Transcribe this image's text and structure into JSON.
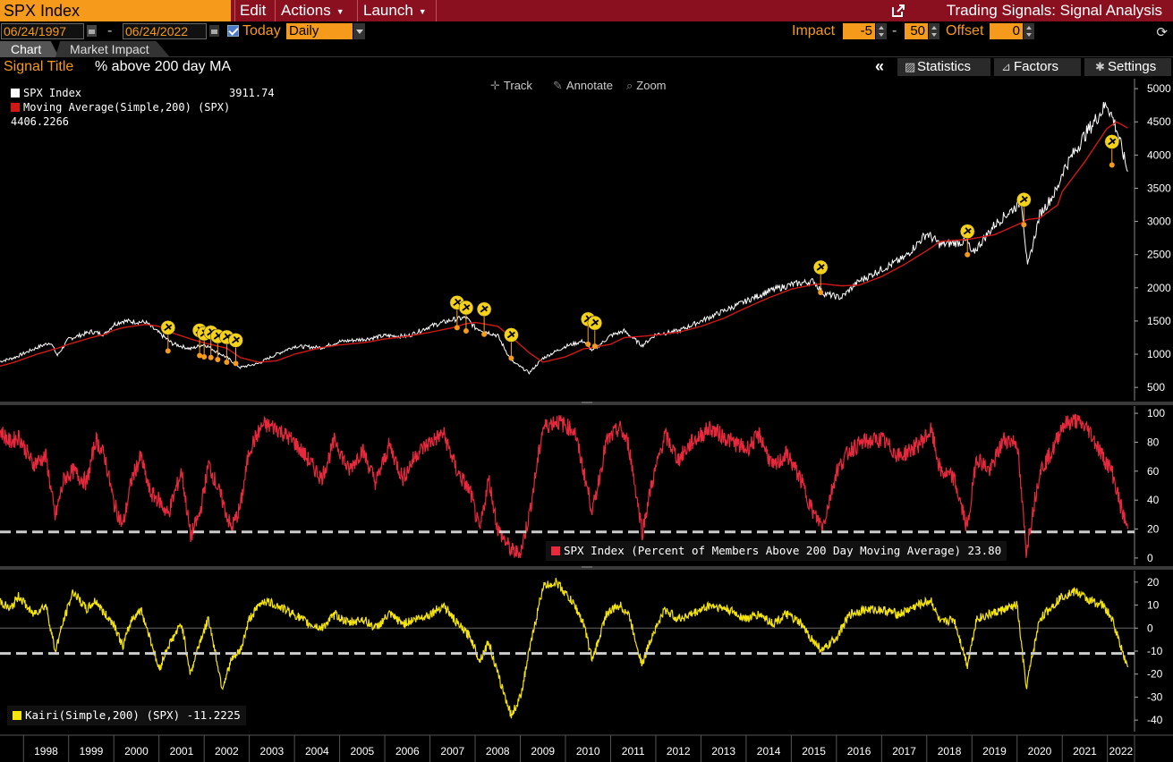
{
  "header": {
    "ticker": "SPX Index",
    "menus": [
      {
        "label": "Edit",
        "has_caret": false
      },
      {
        "label": "Actions",
        "has_caret": true
      },
      {
        "label": "Launch",
        "has_caret": true
      }
    ],
    "title": "Trading Signals: Signal Analysis"
  },
  "controls": {
    "start_date": "06/24/1997",
    "date_separator": "-",
    "end_date": "06/24/2022",
    "today_label": "Today",
    "today_checked": true,
    "frequency": "Daily",
    "impact_label": "Impact",
    "impact_start": "-5",
    "impact_sep": "-",
    "impact_end": "50",
    "offset_label": "Offset",
    "offset_value": "0"
  },
  "tabs": [
    {
      "label": "Chart",
      "active": true
    },
    {
      "label": "Market Impact",
      "active": false
    }
  ],
  "signal": {
    "label": "Signal Title",
    "value": "% above 200 day MA"
  },
  "right_buttons": [
    {
      "label": "Statistics",
      "icon": "statistics-icon"
    },
    {
      "label": "Factors",
      "icon": "factors-icon"
    },
    {
      "label": "Settings",
      "icon": "gear-icon"
    }
  ],
  "chart_toolbar": [
    {
      "label": "Track",
      "icon": "crosshair-icon"
    },
    {
      "label": "Annotate",
      "icon": "pencil-icon"
    },
    {
      "label": "Zoom",
      "icon": "magnifier-icon"
    }
  ],
  "colors": {
    "accent_orange": "#f59a1a",
    "title_bar": "#8a1020",
    "price_line": "#ffffff",
    "ma_line": "#d01818",
    "breadth_line": "#e8283c",
    "kairi_line": "#f5e50a",
    "signal_marker": "#f5d21a",
    "threshold_line": "#cccccc"
  },
  "chart_data": [
    {
      "type": "line",
      "panel": "price",
      "legend": [
        {
          "name": "SPX Index",
          "value": "3911.74",
          "color": "#ffffff"
        },
        {
          "name": "Moving Average(Simple,200) (SPX)",
          "value": "4406.2266",
          "color": "#d01818"
        }
      ],
      "ylim": [
        300,
        5150
      ],
      "yticks": [
        500,
        1000,
        1500,
        2000,
        2500,
        3000,
        3500,
        4000,
        4500,
        5000
      ],
      "x": [
        1997.48,
        1997.8,
        1998.3,
        1998.6,
        1998.75,
        1999.0,
        1999.5,
        1999.8,
        2000.0,
        2000.2,
        2000.7,
        2001.0,
        2001.3,
        2001.7,
        2002.0,
        2002.5,
        2002.8,
        2003.2,
        2003.6,
        2004.0,
        2004.6,
        2005.0,
        2005.6,
        2006.0,
        2006.5,
        2007.0,
        2007.5,
        2007.8,
        2008.0,
        2008.5,
        2008.8,
        2009.2,
        2009.5,
        2010.0,
        2010.4,
        2010.6,
        2011.0,
        2011.3,
        2011.7,
        2012.0,
        2012.5,
        2013.0,
        2013.5,
        2014.0,
        2014.5,
        2015.0,
        2015.5,
        2015.7,
        2016.1,
        2016.5,
        2017.0,
        2017.5,
        2018.0,
        2018.3,
        2018.9,
        2019.0,
        2019.5,
        2020.1,
        2020.23,
        2020.5,
        2020.9,
        2021.0,
        2021.5,
        2021.99,
        2022.2,
        2022.45
      ],
      "series": [
        {
          "name": "SPX Index",
          "values": [
            890,
            950,
            1100,
            1180,
            980,
            1230,
            1340,
            1300,
            1450,
            1500,
            1480,
            1320,
            1160,
            1080,
            1150,
            950,
            800,
            860,
            1000,
            1120,
            1100,
            1190,
            1230,
            1280,
            1270,
            1420,
            1520,
            1550,
            1400,
            1280,
            900,
            720,
            940,
            1120,
            1200,
            1050,
            1280,
            1350,
            1130,
            1300,
            1350,
            1500,
            1650,
            1800,
            1950,
            2050,
            2100,
            1920,
            1850,
            2100,
            2280,
            2450,
            2820,
            2650,
            2700,
            2500,
            2950,
            3300,
            2300,
            3100,
            3500,
            3750,
            4300,
            4780,
            4400,
            3750
          ]
        },
        {
          "name": "Moving Average(Simple,200) (SPX)",
          "values": [
            820,
            880,
            1000,
            1060,
            1090,
            1150,
            1250,
            1300,
            1360,
            1400,
            1450,
            1420,
            1320,
            1230,
            1170,
            1090,
            950,
            880,
            900,
            1000,
            1100,
            1140,
            1180,
            1230,
            1270,
            1330,
            1400,
            1460,
            1480,
            1420,
            1260,
            1020,
            880,
            960,
            1080,
            1100,
            1150,
            1250,
            1270,
            1290,
            1330,
            1420,
            1540,
            1700,
            1850,
            1980,
            2050,
            2060,
            2030,
            2040,
            2170,
            2350,
            2560,
            2700,
            2730,
            2740,
            2800,
            2980,
            3030,
            3050,
            3250,
            3450,
            3900,
            4400,
            4500,
            4406
          ]
        }
      ],
      "signals": [
        {
          "x": 2001.2,
          "y": 1050
        },
        {
          "x": 2001.9,
          "y": 980
        },
        {
          "x": 2002.0,
          "y": 960
        },
        {
          "x": 2002.15,
          "y": 950
        },
        {
          "x": 2002.3,
          "y": 920
        },
        {
          "x": 2002.5,
          "y": 880
        },
        {
          "x": 2002.7,
          "y": 860
        },
        {
          "x": 2007.6,
          "y": 1400
        },
        {
          "x": 2007.8,
          "y": 1350
        },
        {
          "x": 2008.2,
          "y": 1300
        },
        {
          "x": 2008.8,
          "y": 940
        },
        {
          "x": 2010.5,
          "y": 1150
        },
        {
          "x": 2010.65,
          "y": 1120
        },
        {
          "x": 2015.65,
          "y": 1930
        },
        {
          "x": 2018.9,
          "y": 2500
        },
        {
          "x": 2020.15,
          "y": 2950
        },
        {
          "x": 2022.1,
          "y": 3850
        }
      ]
    },
    {
      "type": "line",
      "panel": "breadth",
      "legend": [
        {
          "name": "SPX Index (Percent of Members Above 200 Day Moving Average)",
          "value": "23.80",
          "color": "#e8283c"
        }
      ],
      "ylim": [
        -5,
        105
      ],
      "yticks": [
        0,
        20,
        40,
        60,
        80,
        100
      ],
      "threshold": 18,
      "x": [
        1997.48,
        1997.7,
        1997.9,
        1998.2,
        1998.5,
        1998.7,
        1998.9,
        1999.1,
        1999.4,
        1999.6,
        1999.8,
        2000.0,
        2000.2,
        2000.4,
        2000.6,
        2000.8,
        2001.0,
        2001.2,
        2001.5,
        2001.7,
        2001.9,
        2002.1,
        2002.4,
        2002.6,
        2002.8,
        2003.0,
        2003.3,
        2003.6,
        2004.0,
        2004.3,
        2004.6,
        2004.9,
        2005.2,
        2005.5,
        2005.8,
        2006.1,
        2006.4,
        2006.7,
        2007.0,
        2007.3,
        2007.6,
        2007.9,
        2008.1,
        2008.3,
        2008.5,
        2008.8,
        2009.0,
        2009.2,
        2009.5,
        2009.8,
        2010.2,
        2010.4,
        2010.6,
        2010.9,
        2011.2,
        2011.4,
        2011.7,
        2011.9,
        2012.2,
        2012.5,
        2012.8,
        2013.2,
        2013.6,
        2014.0,
        2014.3,
        2014.6,
        2014.9,
        2015.2,
        2015.5,
        2015.7,
        2016.0,
        2016.3,
        2016.6,
        2017.0,
        2017.4,
        2017.8,
        2018.1,
        2018.3,
        2018.6,
        2018.9,
        2019.1,
        2019.4,
        2019.7,
        2020.0,
        2020.2,
        2020.5,
        2020.8,
        2021.0,
        2021.3,
        2021.6,
        2021.9,
        2022.1,
        2022.3,
        2022.45
      ],
      "values": [
        88,
        80,
        84,
        65,
        70,
        28,
        55,
        60,
        52,
        82,
        70,
        38,
        22,
        55,
        70,
        45,
        40,
        30,
        60,
        15,
        30,
        65,
        40,
        20,
        35,
        75,
        92,
        90,
        80,
        68,
        55,
        82,
        60,
        75,
        52,
        78,
        55,
        72,
        80,
        86,
        60,
        45,
        18,
        55,
        20,
        5,
        3,
        30,
        90,
        95,
        88,
        60,
        32,
        80,
        90,
        78,
        18,
        50,
        85,
        68,
        80,
        90,
        82,
        75,
        85,
        62,
        72,
        55,
        30,
        22,
        60,
        75,
        80,
        82,
        70,
        78,
        88,
        60,
        55,
        20,
        70,
        60,
        82,
        80,
        5,
        60,
        75,
        92,
        95,
        88,
        70,
        60,
        35,
        20
      ]
    },
    {
      "type": "line",
      "panel": "kairi",
      "legend": [
        {
          "name": "Kairi(Simple,200) (SPX)",
          "value": "-11.2225",
          "color": "#f5e50a"
        }
      ],
      "ylim": [
        -45,
        25
      ],
      "yticks": [
        -40,
        -30,
        -20,
        -10,
        0,
        10,
        20
      ],
      "threshold": -11,
      "x": [
        1997.48,
        1997.7,
        1997.9,
        1998.2,
        1998.5,
        1998.7,
        1998.9,
        1999.1,
        1999.4,
        1999.6,
        1999.8,
        2000.0,
        2000.2,
        2000.4,
        2000.6,
        2000.8,
        2001.0,
        2001.2,
        2001.5,
        2001.7,
        2001.9,
        2002.1,
        2002.4,
        2002.6,
        2002.8,
        2003.0,
        2003.3,
        2003.6,
        2004.0,
        2004.3,
        2004.6,
        2004.9,
        2005.2,
        2005.5,
        2005.8,
        2006.1,
        2006.4,
        2006.7,
        2007.0,
        2007.3,
        2007.6,
        2007.9,
        2008.1,
        2008.3,
        2008.5,
        2008.8,
        2009.0,
        2009.2,
        2009.5,
        2009.8,
        2010.2,
        2010.4,
        2010.6,
        2010.9,
        2011.2,
        2011.4,
        2011.7,
        2011.9,
        2012.2,
        2012.5,
        2012.8,
        2013.2,
        2013.6,
        2014.0,
        2014.3,
        2014.6,
        2014.9,
        2015.2,
        2015.5,
        2015.7,
        2016.0,
        2016.3,
        2016.6,
        2017.0,
        2017.4,
        2017.8,
        2018.1,
        2018.3,
        2018.6,
        2018.9,
        2019.1,
        2019.4,
        2019.7,
        2020.0,
        2020.2,
        2020.5,
        2020.8,
        2021.0,
        2021.3,
        2021.6,
        2021.9,
        2022.1,
        2022.3,
        2022.45
      ],
      "values": [
        12,
        8,
        14,
        6,
        10,
        -10,
        4,
        16,
        8,
        12,
        6,
        2,
        -8,
        4,
        8,
        -4,
        -18,
        -8,
        2,
        -20,
        -6,
        4,
        -26,
        -14,
        -10,
        4,
        12,
        10,
        6,
        2,
        0,
        6,
        2,
        4,
        0,
        6,
        2,
        4,
        6,
        10,
        2,
        -4,
        -14,
        -6,
        -20,
        -38,
        -30,
        -10,
        18,
        20,
        10,
        2,
        -14,
        6,
        10,
        6,
        -16,
        -4,
        8,
        4,
        6,
        10,
        8,
        4,
        6,
        2,
        6,
        2,
        -6,
        -10,
        -4,
        6,
        8,
        8,
        6,
        10,
        12,
        2,
        4,
        -16,
        4,
        6,
        8,
        10,
        -26,
        4,
        10,
        14,
        16,
        12,
        10,
        4,
        -8,
        -17
      ]
    }
  ],
  "x_axis": {
    "labels": [
      "1998",
      "1999",
      "2000",
      "2001",
      "2002",
      "2003",
      "2004",
      "2005",
      "2006",
      "2007",
      "2008",
      "2009",
      "2010",
      "2011",
      "2012",
      "2013",
      "2014",
      "2015",
      "2016",
      "2017",
      "2018",
      "2019",
      "2020",
      "2021",
      "2022"
    ],
    "range": [
      1997.48,
      2022.6
    ]
  }
}
